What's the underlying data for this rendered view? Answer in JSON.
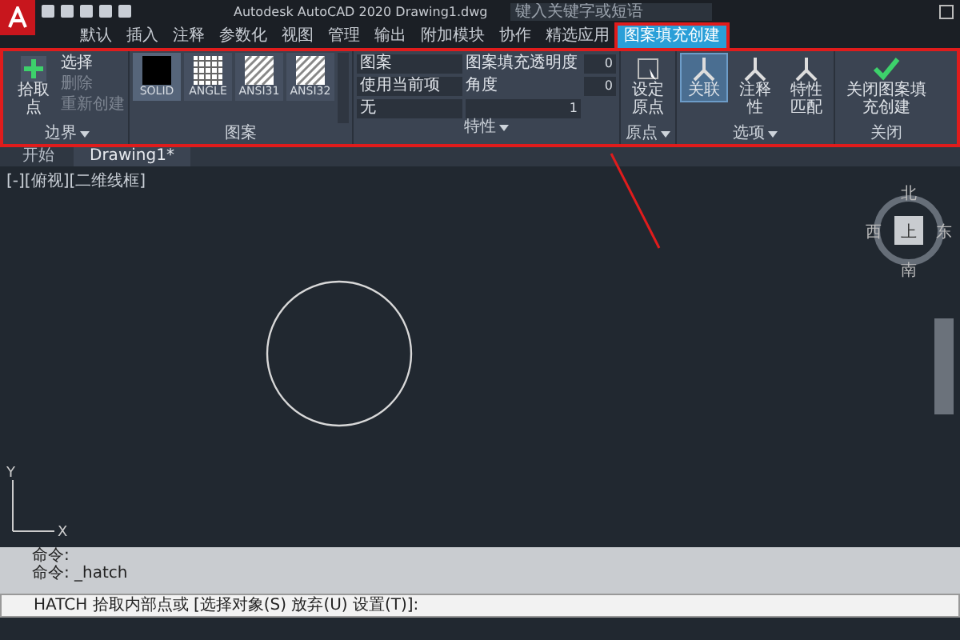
{
  "window": {
    "title": "Autodesk AutoCAD 2020  Drawing1.dwg",
    "search": {
      "placeholder": "键入关键字或短语"
    }
  },
  "ribbon_tabs": [
    {
      "label": "默认",
      "selected": false
    },
    {
      "label": "插入",
      "selected": false
    },
    {
      "label": "注释",
      "selected": false
    },
    {
      "label": "参数化",
      "selected": false
    },
    {
      "label": "视图",
      "selected": false
    },
    {
      "label": "管理",
      "selected": false
    },
    {
      "label": "输出",
      "selected": false
    },
    {
      "label": "附加模块",
      "selected": false
    },
    {
      "label": "协作",
      "selected": false
    },
    {
      "label": "精选应用",
      "selected": false
    },
    {
      "label": "图案填充创建",
      "selected": true
    }
  ],
  "boundary": {
    "title": "边界",
    "pick_button": "拾取点",
    "items": [
      {
        "label": "选择",
        "disabled": false
      },
      {
        "label": "删除",
        "disabled": true
      },
      {
        "label": "重新创建",
        "disabled": true
      }
    ]
  },
  "pattern": {
    "title": "图案",
    "swatches": [
      {
        "label": "SOLID",
        "kind": "solid",
        "selected": true
      },
      {
        "label": "ANGLE",
        "kind": "grid",
        "selected": false
      },
      {
        "label": "ANSI31",
        "kind": "hatch",
        "selected": false
      },
      {
        "label": "ANSI32",
        "kind": "hatch",
        "selected": false
      }
    ]
  },
  "properties": {
    "title": "特性",
    "type": "图案",
    "current_color": "使用当前项",
    "background": "无",
    "transparency_label": "图案填充透明度",
    "transparency": "0",
    "angle_label": "角度",
    "angle": "0",
    "scale": "1"
  },
  "origin": {
    "title": "原点",
    "button": "设定原点"
  },
  "options": {
    "title": "选项",
    "buttons": [
      {
        "label": "关联",
        "selected": true
      },
      {
        "label": "注释性",
        "selected": false
      },
      {
        "label": "特性匹配",
        "selected": false
      }
    ]
  },
  "close": {
    "title": "关闭",
    "button": "关闭图案填充创建"
  },
  "file_tabs": [
    {
      "label": "开始",
      "selected": false
    },
    {
      "label": "Drawing1*",
      "selected": true
    }
  ],
  "viewport": {
    "label": "[-][俯视][二维线框]",
    "viewcube": {
      "face": "上",
      "north": "北",
      "south": "南",
      "east": "东",
      "west": "西"
    },
    "ucs": {
      "x": "X",
      "y": "Y"
    }
  },
  "command": {
    "history": [
      "命令:",
      "命令: _hatch"
    ],
    "prompt": "HATCH 拾取内部点或 [选择对象(S) 放弃(U) 设置(T)]:"
  }
}
